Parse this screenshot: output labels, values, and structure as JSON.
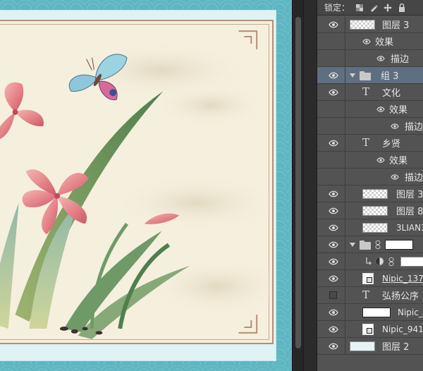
{
  "lock_bar": {
    "label": "锁定："
  },
  "layers": [
    {
      "kind": "layer",
      "name": "图层 3",
      "visible": true,
      "thumb": "checker",
      "indent": 0
    },
    {
      "kind": "effects",
      "name": "效果",
      "indent": 1
    },
    {
      "kind": "effect",
      "name": "描边",
      "indent": 2
    },
    {
      "kind": "group",
      "name": "组 3",
      "visible": true,
      "selected": true,
      "expanded": true
    },
    {
      "kind": "text",
      "name": "文化",
      "visible": true
    },
    {
      "kind": "effects",
      "name": "效果",
      "indent": 1
    },
    {
      "kind": "effect",
      "name": "描边",
      "indent": 2
    },
    {
      "kind": "text",
      "name": "乡贤",
      "visible": true
    },
    {
      "kind": "effects",
      "name": "效果",
      "indent": 1
    },
    {
      "kind": "effect",
      "name": "描边",
      "indent": 2
    },
    {
      "kind": "layer",
      "name": "图层 3",
      "visible": true,
      "thumb": "checker"
    },
    {
      "kind": "layer",
      "name": "图层 8",
      "visible": true,
      "thumb": "checker"
    },
    {
      "kind": "layer",
      "name": "3LIAN3",
      "visible": true,
      "thumb": "checker"
    },
    {
      "kind": "group-mask",
      "name": "",
      "visible": true,
      "expanded": true
    },
    {
      "kind": "adjustment",
      "name": "",
      "visible": true
    },
    {
      "kind": "smart",
      "name": "Nipic_137",
      "visible": true
    },
    {
      "kind": "text",
      "name": "弘扬公序",
      "visible": false
    },
    {
      "kind": "layer",
      "name": "Nipic_",
      "visible": true,
      "thumb": "white-black",
      "link": true
    },
    {
      "kind": "smart",
      "name": "Nipic_941",
      "visible": true
    },
    {
      "kind": "layer",
      "name": "图层 2",
      "visible": true,
      "thumb": "solid",
      "link": true
    }
  ],
  "colors": {
    "canvas_bg": "#5eb6c2",
    "panel_bg": "#535353",
    "selected_row": "#5e6f80",
    "frame_brown": "#b58e72"
  },
  "icons": [
    "eye-icon",
    "lock-icon",
    "brush-icon",
    "move-icon",
    "folder-icon",
    "text-layer-icon",
    "link-icon",
    "mask-icon",
    "smart-object-icon",
    "adjustment-icon",
    "clip-arrow-icon"
  ]
}
